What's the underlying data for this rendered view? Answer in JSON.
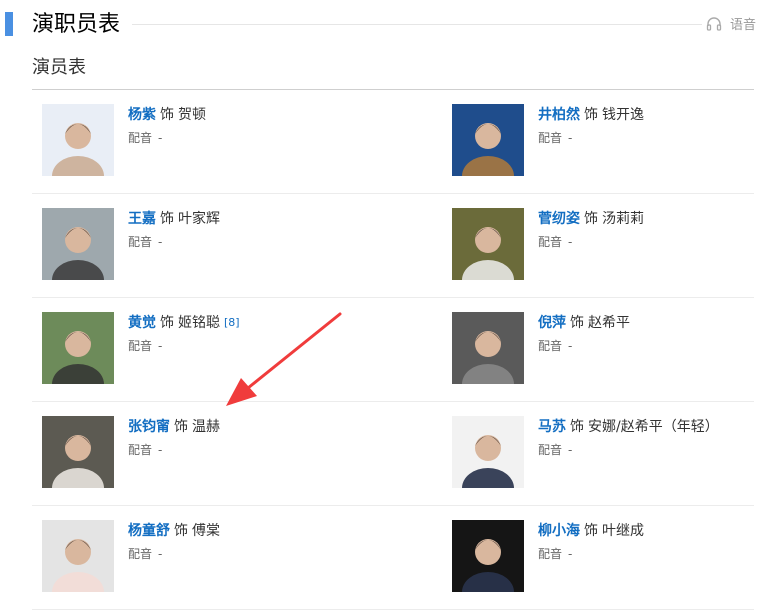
{
  "header": {
    "title": "演职员表",
    "voice_label": "语音",
    "subtitle": "演员表"
  },
  "cast": [
    {
      "actor": "杨紫",
      "shi": "饰",
      "role": "贺顿",
      "cite": "",
      "dub_label": "配音",
      "dub_value": "-",
      "bg": "#e9eef6",
      "fg": "#c9a98f"
    },
    {
      "actor": "井柏然",
      "shi": "饰",
      "role": "钱开逸",
      "cite": "",
      "dub_label": "配音",
      "dub_value": "-",
      "bg": "#1f4d8c",
      "fg": "#b07a3a"
    },
    {
      "actor": "王嘉",
      "shi": "饰",
      "role": "叶家辉",
      "cite": "",
      "dub_label": "配音",
      "dub_value": "-",
      "bg": "#9ea8ad",
      "fg": "#3a3a3a"
    },
    {
      "actor": "菅纫姿",
      "shi": "饰",
      "role": "汤莉莉",
      "cite": "",
      "dub_label": "配音",
      "dub_value": "-",
      "bg": "#6b6b3a",
      "fg": "#eeeeee"
    },
    {
      "actor": "黄觉",
      "shi": "饰",
      "role": "姬铭聪",
      "cite": "[8]",
      "dub_label": "配音",
      "dub_value": "-",
      "bg": "#6d8b5a",
      "fg": "#333333"
    },
    {
      "actor": "倪萍",
      "shi": "饰",
      "role": "赵希平",
      "cite": "",
      "dub_label": "配音",
      "dub_value": "-",
      "bg": "#5a5a5a",
      "fg": "#8a8a8a"
    },
    {
      "actor": "张钧甯",
      "shi": "饰",
      "role": "温赫",
      "cite": "",
      "dub_label": "配音",
      "dub_value": "-",
      "bg": "#5c5a52",
      "fg": "#f0ece6"
    },
    {
      "actor": "马苏",
      "shi": "饰",
      "role": "安娜/赵希平（年轻）",
      "cite": "",
      "dub_label": "配音",
      "dub_value": "-",
      "bg": "#f2f2f2",
      "fg": "#1a2540"
    },
    {
      "actor": "杨童舒",
      "shi": "饰",
      "role": "傅棠",
      "cite": "",
      "dub_label": "配音",
      "dub_value": "-",
      "bg": "#e4e4e4",
      "fg": "#f4dcd6"
    },
    {
      "actor": "柳小海",
      "shi": "饰",
      "role": "叶继成",
      "cite": "",
      "dub_label": "配音",
      "dub_value": "-",
      "bg": "#151515",
      "fg": "#2a3550"
    }
  ],
  "colors": {
    "accent": "#4a90e2",
    "link": "#136ec2",
    "arrow": "#f03c3c"
  }
}
